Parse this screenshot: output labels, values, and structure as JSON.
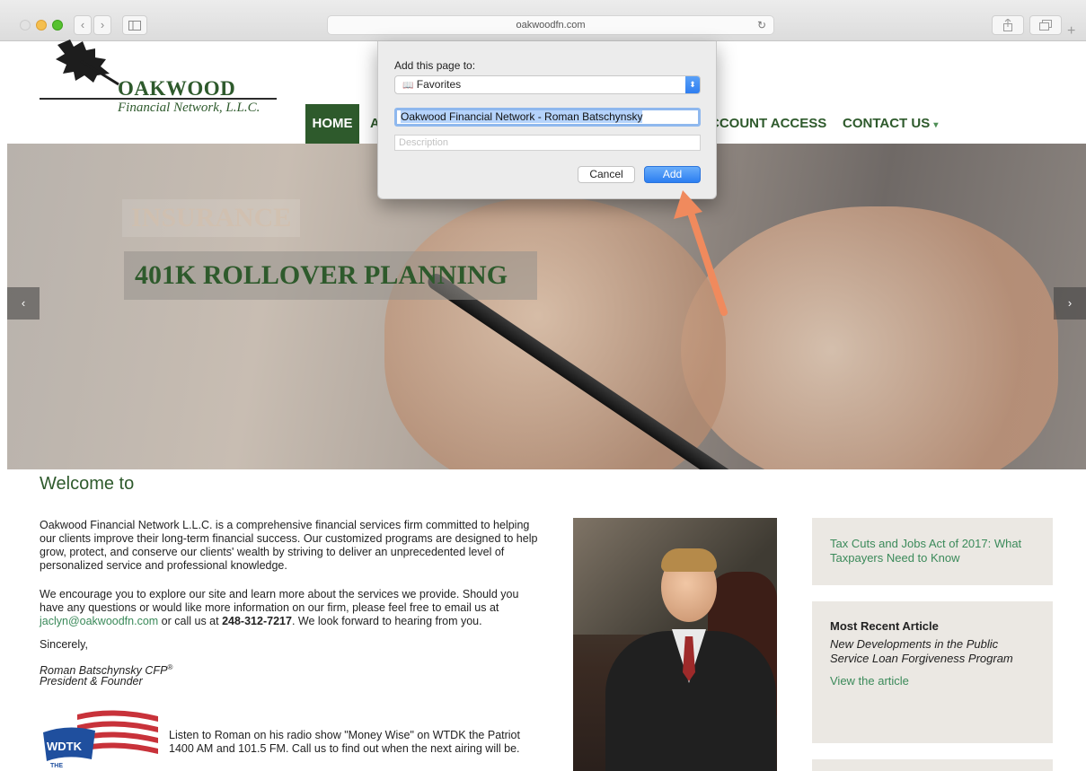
{
  "browser": {
    "url": "oakwoodfn.com",
    "reload_glyph": "↻",
    "back_glyph": "‹",
    "forward_glyph": "›",
    "plus_glyph": "+"
  },
  "site": {
    "logo_name": "OAKWOOD",
    "logo_sub": "Financial Network, L.L.C.",
    "nav": {
      "home": "HOME",
      "a_partial": "A",
      "account_access": "CCOUNT ACCESS",
      "contact_us": "CONTACT US",
      "contact_caret": "▾"
    }
  },
  "hero": {
    "faint_title": "INSURANCE",
    "title": "401K ROLLOVER PLANNING",
    "prev_arrow": "‹",
    "next_arrow": "›"
  },
  "content": {
    "welcome": "Welcome to",
    "para1": "Oakwood Financial Network L.L.C. is a comprehensive financial services firm committed to helping our clients improve their long-term financial success. Our customized programs are designed to help grow, protect, and conserve our clients' wealth by striving to deliver an unprecedented level of personalized service and professional knowledge.",
    "para2_a": "We encourage you to explore our site and learn more about the services we provide. Should you have any questions or would like more information on our firm, please feel free to email us at ",
    "email": "jaclyn@oakwoodfn.com",
    "para2_b": " or call us at ",
    "phone": "248-312-7217",
    "para2_c": ". We look forward to hearing from you.",
    "sincerely": "Sincerely,",
    "signer_name": "Roman Batschynsky CFP",
    "signer_sup": "®",
    "signer_title": "President & Founder",
    "wdtk_logo": "WDTK",
    "wdtk_sub": "THE",
    "radio_text": "Listen to Roman on his radio show \"Money Wise\" on WTDK the Patriot 1400 AM and 101.5 FM. Call us to find out when the next airing will be."
  },
  "sidebar": {
    "tax_link": "Tax Cuts and Jobs Act of 2017: What Taxpayers Need to Know",
    "recent_heading": "Most Recent Article",
    "recent_title": "New Developments in the Public Service Loan Forgiveness Program",
    "view_article": "View the article"
  },
  "dialog": {
    "label": "Add this page to:",
    "folder_icon": "📖",
    "folder": "Favorites",
    "stepper": "⬍",
    "title_value": "Oakwood Financial Network - Roman Batschynsky",
    "description_placeholder": "Description",
    "cancel": "Cancel",
    "add": "Add"
  },
  "colors": {
    "brand_green": "#2e5a2c",
    "link_green": "#3b8a5a",
    "annotation_arrow": "#f08a5d",
    "accent_blue": "#2c7ef1"
  }
}
